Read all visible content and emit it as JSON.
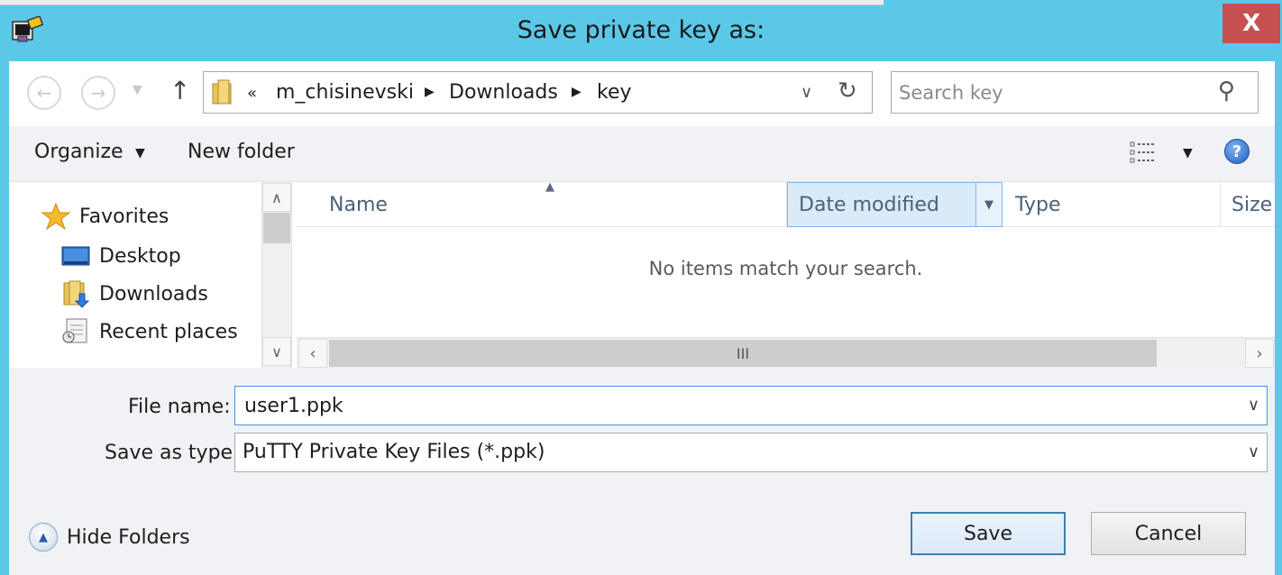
{
  "window": {
    "title": "Save private key as:",
    "close_label": "X"
  },
  "nav": {
    "back_icon": "back-arrow-icon",
    "forward_icon": "forward-arrow-icon",
    "up_icon": "up-arrow-icon",
    "overflow": "«",
    "breadcrumbs": [
      "m_chisinevski",
      "Downloads",
      "key"
    ],
    "search_placeholder": "Search key"
  },
  "toolbar": {
    "organize_label": "Organize",
    "new_folder_label": "New folder",
    "help_label": "?"
  },
  "sidebar": {
    "items": [
      {
        "label": "Favorites",
        "icon": "star-icon"
      },
      {
        "label": "Desktop",
        "icon": "desktop-icon"
      },
      {
        "label": "Downloads",
        "icon": "downloads-folder-icon"
      },
      {
        "label": "Recent places",
        "icon": "recent-places-icon"
      }
    ]
  },
  "filelist": {
    "columns": [
      "Name",
      "Date modified",
      "Type",
      "Size"
    ],
    "sorted_column": "Date modified",
    "empty_message": "No items match your search.",
    "scroll_grip": "III"
  },
  "form": {
    "file_name_label": "File name:",
    "file_name_value": "user1.ppk",
    "save_type_label": "Save as type:",
    "save_type_value": "PuTTY Private Key Files (*.ppk)"
  },
  "footer": {
    "hide_folders_label": "Hide Folders",
    "save_label": "Save",
    "cancel_label": "Cancel"
  },
  "colors": {
    "titlebar": "#5bc8e8",
    "close": "#c75050",
    "accent_border": "#4a90d9"
  }
}
